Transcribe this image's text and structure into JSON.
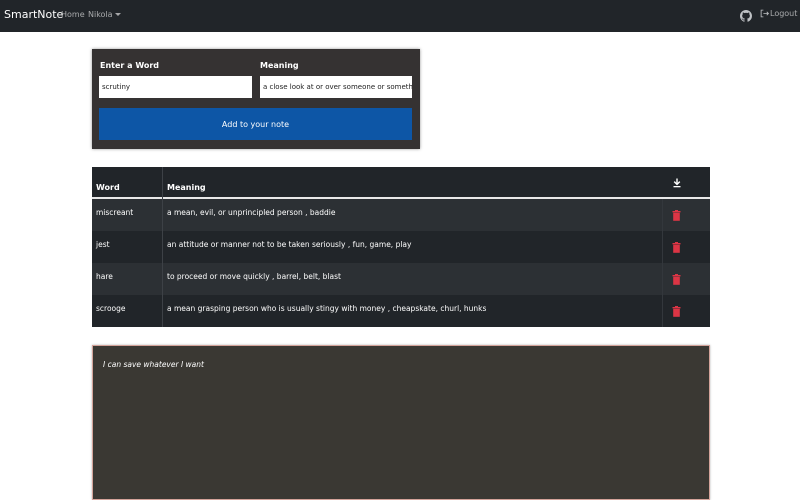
{
  "navbar": {
    "brand": "SmartNote",
    "home_label": "Home",
    "user_label": "Nikola",
    "logout_label": "Logout"
  },
  "form": {
    "word_label": "Enter a Word",
    "meaning_label": "Meaning",
    "word_value": "scrutiny",
    "meaning_value": "a close look at or over someone or someth",
    "add_button_label": "Add to your note",
    "button_color": "#0d56a6"
  },
  "table": {
    "headers": {
      "word": "Word",
      "meaning": "Meaning"
    },
    "rows": [
      {
        "word": "miscreant",
        "meaning": "a mean, evil, or unprincipled person , baddie"
      },
      {
        "word": "jest",
        "meaning": "an attitude or manner not to be taken seriously , fun, game, play"
      },
      {
        "word": "hare",
        "meaning": "to proceed or move quickly , barrel, belt, blast"
      },
      {
        "word": "scrooge",
        "meaning": "a mean grasping person who is usually stingy with money , cheapskate, churl, hunks"
      }
    ],
    "delete_icon_color": "#dc3545"
  },
  "notepad": {
    "text": "I can save whatever I want"
  }
}
